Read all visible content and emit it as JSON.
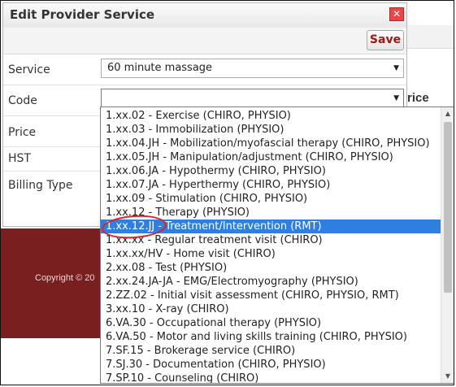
{
  "dialog": {
    "title": "Edit Provider Service",
    "close_glyph": "✕",
    "save_label": "Save"
  },
  "form": {
    "service_label": "Service",
    "service_value": "60 minute massage",
    "code_label": "Code",
    "code_value": "",
    "price_label": "Price",
    "hst_label": "HST",
    "billing_type_label": "Billing Type"
  },
  "background": {
    "price_header": "rice",
    "footer_copyright": "Copyright © 20"
  },
  "dropdown": {
    "selected_index": 7,
    "options": [
      "1.xx.02 - Exercise (CHIRO, PHYSIO)",
      "1.xx.03 - Immobilization (PHYSIO)",
      "1.xx.04.JH - Mobilization/myofascial therapy (CHIRO, PHYSIO)",
      "1.xx.05.JH - Manipulation/adjustment (CHIRO, PHYSIO)",
      "1.xx.06.JA - Hypothermy (CHIRO, PHYSIO)",
      "1.xx.07.JA - Hyperthermy (CHIRO, PHYSIO)",
      "1.xx.09 - Stimulation (CHIRO, PHYSIO)",
      "1.xx.12 - Therapy (PHYSIO)",
      "1.xx.12.JJ - Treatment/Intervention (RMT)",
      "1.xx.xx - Regular treatment visit (CHIRO)",
      "1.xx.xx/HV - Home visit (CHIRO)",
      "2.xx.08 - Test (PHYSIO)",
      "2.xx.24.JA-JA - EMG/Electromyography (PHYSIO)",
      "2.ZZ.02 - Initial visit assessment (CHIRO, PHYSIO, RMT)",
      "3.xx.10 - X-ray (CHIRO)",
      "6.VA.30 - Occupational therapy (PHYSIO)",
      "6.VA.50 - Motor and living skills training (CHIRO, PHYSIO)",
      "7.SF.15 - Brokerage service (CHIRO)",
      "7.SJ.30 - Documentation (CHIRO, PHYSIO)",
      "7.SP.10 - Counseling (CHIRO)"
    ]
  },
  "colors": {
    "selected_bg": "#2f7fe0",
    "save_text": "#a01515",
    "close_bg": "#e44",
    "footer_bg": "#7a1f1f",
    "annotation": "#d22"
  },
  "icons": {
    "close": "close-icon",
    "dropdown_arrow": "chevron-down-icon",
    "scroll_up": "scroll-up-arrow-icon",
    "scroll_down": "scroll-down-arrow-icon"
  }
}
